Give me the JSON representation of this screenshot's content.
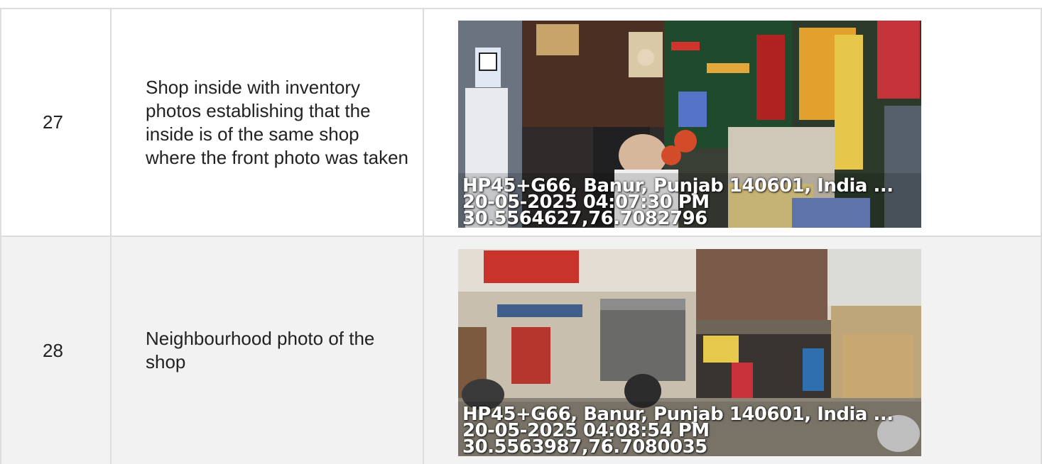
{
  "rows": [
    {
      "number": "27",
      "description": "Shop inside with inventory photos establishing that the inside is of the same shop where the front photo was taken",
      "photo": {
        "address": "HP45+G66, Banur, Punjab 140601, India ...",
        "timestamp": "20-05-2025 04:07:30 PM",
        "coordinates": "30.5564627,76.7082796"
      }
    },
    {
      "number": "28",
      "description": "Neighbourhood photo of the shop",
      "photo": {
        "address": "HP45+G66, Banur, Punjab 140601, India ...",
        "timestamp": "20-05-2025 04:08:54 PM",
        "coordinates": "30.5563987,76.7080035"
      }
    }
  ]
}
